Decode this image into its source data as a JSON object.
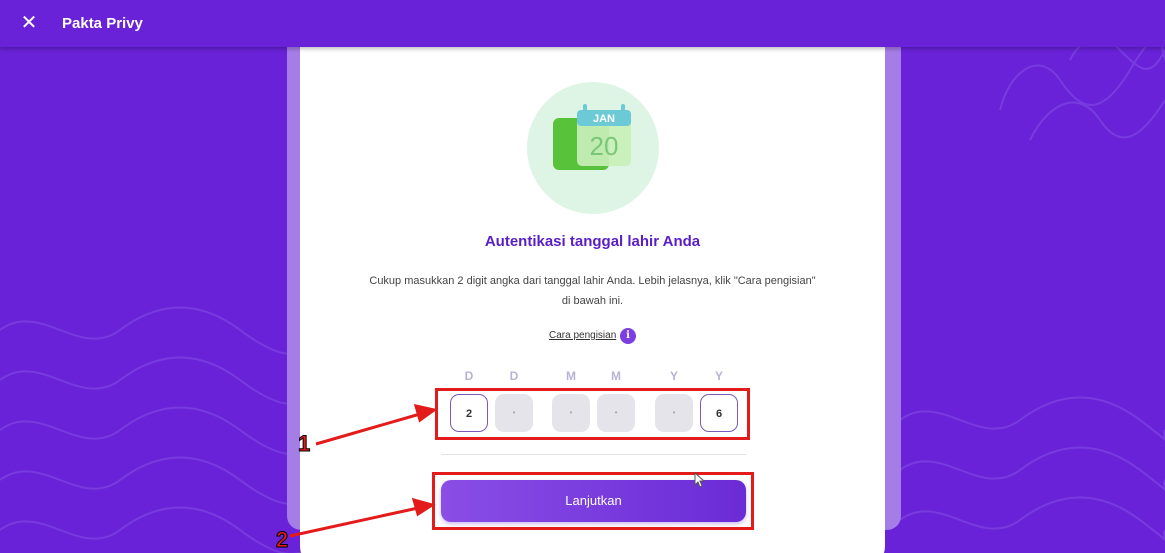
{
  "app": {
    "title": "Pakta Privy",
    "close_icon": "close-icon"
  },
  "illustration": {
    "month": "JAN",
    "day": "20",
    "icon": "calendar-icon"
  },
  "content": {
    "heading": "Autentikasi tanggal lahir Anda",
    "description_line1": "Cukup masukkan 2 digit angka dari tanggal lahir Anda. Lebih jelasnya, klik \"Cara pengisian\"",
    "description_line2": "di bawah ini.",
    "help_link": "Cara pengisian",
    "info_icon_glyph": "i"
  },
  "dob_input": {
    "labels": [
      "D",
      "D",
      "M",
      "M",
      "Y",
      "Y"
    ],
    "digits": [
      "2",
      "•",
      "•",
      "•",
      "•",
      "6"
    ]
  },
  "actions": {
    "continue_label": "Lanjutkan"
  },
  "annotations": {
    "step1": "1",
    "step2": "2"
  },
  "colors": {
    "brand_purple": "#6a22d8",
    "accent": "#5a1ec7",
    "annotation_red": "#e31b1b"
  }
}
